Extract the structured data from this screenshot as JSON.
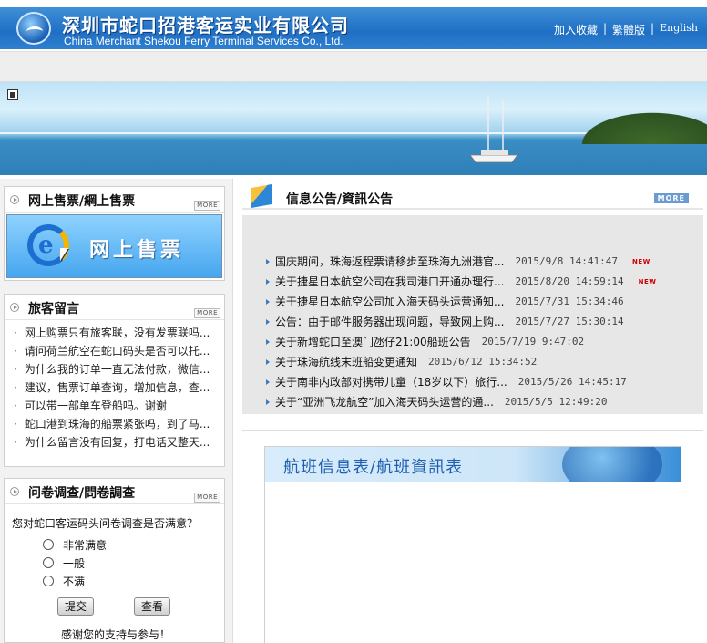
{
  "header": {
    "company_cn": "深圳市蛇口招港客运实业有限公司",
    "company_en": "China Merchant Shekou Ferry Terminal Services Co., Ltd.",
    "links": [
      "加入收藏",
      "繁體版",
      "English"
    ],
    "separator": "|"
  },
  "left": {
    "ticket_panel": {
      "title": "网上售票/網上售票",
      "more": "MORE",
      "banner_label": "网上售票"
    },
    "message_panel": {
      "title": "旅客留言",
      "more": "MORE",
      "items": [
        "网上购票只有旅客联，没有发票联吗...",
        "请问荷兰航空在蛇口码头是否可以托...",
        "为什么我的订单一直无法付款，微信...",
        "建议，售票订单查询，增加信息，查...",
        "可以带一部单车登船吗。谢谢",
        "蛇口港到珠海的船票紧张吗，到了马...",
        "为什么留言没有回复，打电话又整天..."
      ]
    },
    "survey_panel": {
      "title": "问卷调查/問卷調查",
      "more": "MORE",
      "question": "您对蛇口客运码头问卷调查是否满意？",
      "options": [
        "非常满意",
        "一般",
        "不满"
      ],
      "submit": "提交",
      "view": "查看",
      "thanks": "感谢您的支持与参与！"
    }
  },
  "right": {
    "notice_title": "信息公告/資訊公告",
    "notice_more": "MORE",
    "new_label": "NEW",
    "notices": [
      {
        "text": "国庆期间，珠海返程票请移步至珠海九洲港官...",
        "date": "2015/9/8 14:41:47",
        "new": true
      },
      {
        "text": "关于捷星日本航空公司在我司港口开通办理行...",
        "date": "2015/8/20 14:59:14",
        "new": true
      },
      {
        "text": "关于捷星日本航空公司加入海天码头运营通知...",
        "date": "2015/7/31 15:34:46",
        "new": false
      },
      {
        "text": "公告：由于邮件服务器出现问题，导致网上购...",
        "date": "2015/7/27 15:30:14",
        "new": false
      },
      {
        "text": "关于新增蛇口至澳门氹仔21:00船班公告",
        "date": "2015/7/19 9:47:02",
        "new": false
      },
      {
        "text": "关于珠海航线末班船变更通知",
        "date": "2015/6/12 15:34:52",
        "new": false
      },
      {
        "text": "关于南非内政部对携带儿童（18岁以下）旅行...",
        "date": "2015/5/26 14:45:17",
        "new": false
      },
      {
        "text": "关于“亚洲飞龙航空”加入海天码头运营的通...",
        "date": "2015/5/5 12:49:20",
        "new": false
      }
    ],
    "schedule_title": "航班信息表/航班資訊表"
  }
}
